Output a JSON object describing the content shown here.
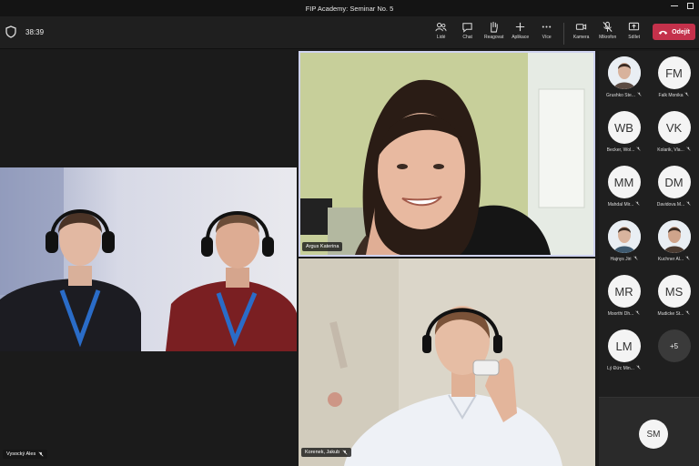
{
  "window": {
    "title": "FIP Academy: Seminar No. 5"
  },
  "toolbar": {
    "timer": "38:39",
    "buttons": [
      {
        "label": "Lidé",
        "icon": "people-icon"
      },
      {
        "label": "Chat",
        "icon": "chat-icon"
      },
      {
        "label": "Reagovat",
        "icon": "raise-hand-icon"
      },
      {
        "label": "Aplikace",
        "icon": "add-icon"
      },
      {
        "label": "Více",
        "icon": "more-icon"
      },
      {
        "label": "Kamera",
        "icon": "camera-icon"
      },
      {
        "label": "Mikrofon",
        "icon": "mic-off-icon"
      },
      {
        "label": "Sdílet",
        "icon": "share-icon"
      }
    ],
    "leave_label": "Odejít"
  },
  "videos": {
    "left_tile_name": "Vysocký Ales",
    "top_right_name": "Argus Katerina",
    "bottom_right_name": "Korenek, Jakub"
  },
  "participants": [
    {
      "initials": "",
      "name": "Grushko Ste...",
      "photo": true
    },
    {
      "initials": "FM",
      "name": "Falk Monika",
      "photo": false
    },
    {
      "initials": "WB",
      "name": "Becker, Wol...",
      "photo": false
    },
    {
      "initials": "VK",
      "name": "Kolarik, Vla...",
      "photo": false
    },
    {
      "initials": "MM",
      "name": "Mahdal Mir...",
      "photo": false
    },
    {
      "initials": "DM",
      "name": "Davidova M...",
      "photo": false
    },
    {
      "initials": "",
      "name": "Hajnys Jiri",
      "photo": true
    },
    {
      "initials": "",
      "name": "Kuchner Al...",
      "photo": true
    },
    {
      "initials": "MR",
      "name": "Moorthi Dh...",
      "photo": false
    },
    {
      "initials": "MS",
      "name": "Mudicke St...",
      "photo": false
    },
    {
      "initials": "LM",
      "name": "Lý Đức Min...",
      "photo": false
    }
  ],
  "more_participants": "+5",
  "self": {
    "initials": "SM"
  },
  "colors": {
    "leave": "#c4314b",
    "background": "#1b1b1b"
  }
}
